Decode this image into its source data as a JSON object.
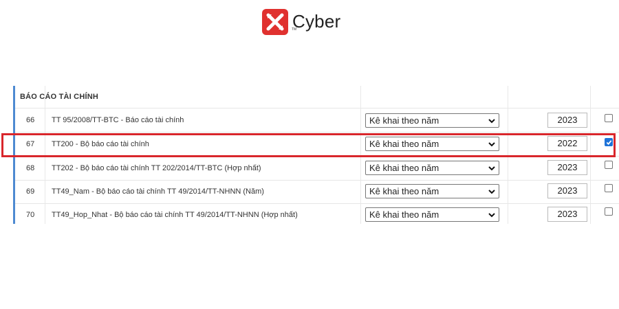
{
  "brand": {
    "name": "Cyber",
    "tm": "TM",
    "color": "#e0312f"
  },
  "section": {
    "title": "BÁO CÁO TÀI CHÍNH"
  },
  "rows": [
    {
      "num": "66",
      "name": "TT 95/2008/TT-BTC - Báo cáo tài chính",
      "period": "Kê khai theo năm",
      "year": "2023",
      "checked": false
    },
    {
      "num": "67",
      "name": "TT200 - Bộ báo cáo tài chính",
      "period": "Kê khai theo năm",
      "year": "2022",
      "checked": true
    },
    {
      "num": "68",
      "name": "TT202 - Bộ báo cáo tài chính TT 202/2014/TT-BTC (Hợp nhất)",
      "period": "Kê khai theo năm",
      "year": "2023",
      "checked": false
    },
    {
      "num": "69",
      "name": "TT49_Nam - Bộ báo cáo tài chính TT 49/2014/TT-NHNN (Năm)",
      "period": "Kê khai theo năm",
      "year": "2023",
      "checked": false
    },
    {
      "num": "70",
      "name": "TT49_Hop_Nhat - Bộ báo cáo tài chính TT 49/2014/TT-NHNN (Hợp nhất)",
      "period": "Kê khai theo năm",
      "year": "2023",
      "checked": false
    }
  ],
  "colors": {
    "highlight": "#d9262b",
    "accent": "#4d8ad1",
    "checkbox_checked": "#1e73d8"
  }
}
